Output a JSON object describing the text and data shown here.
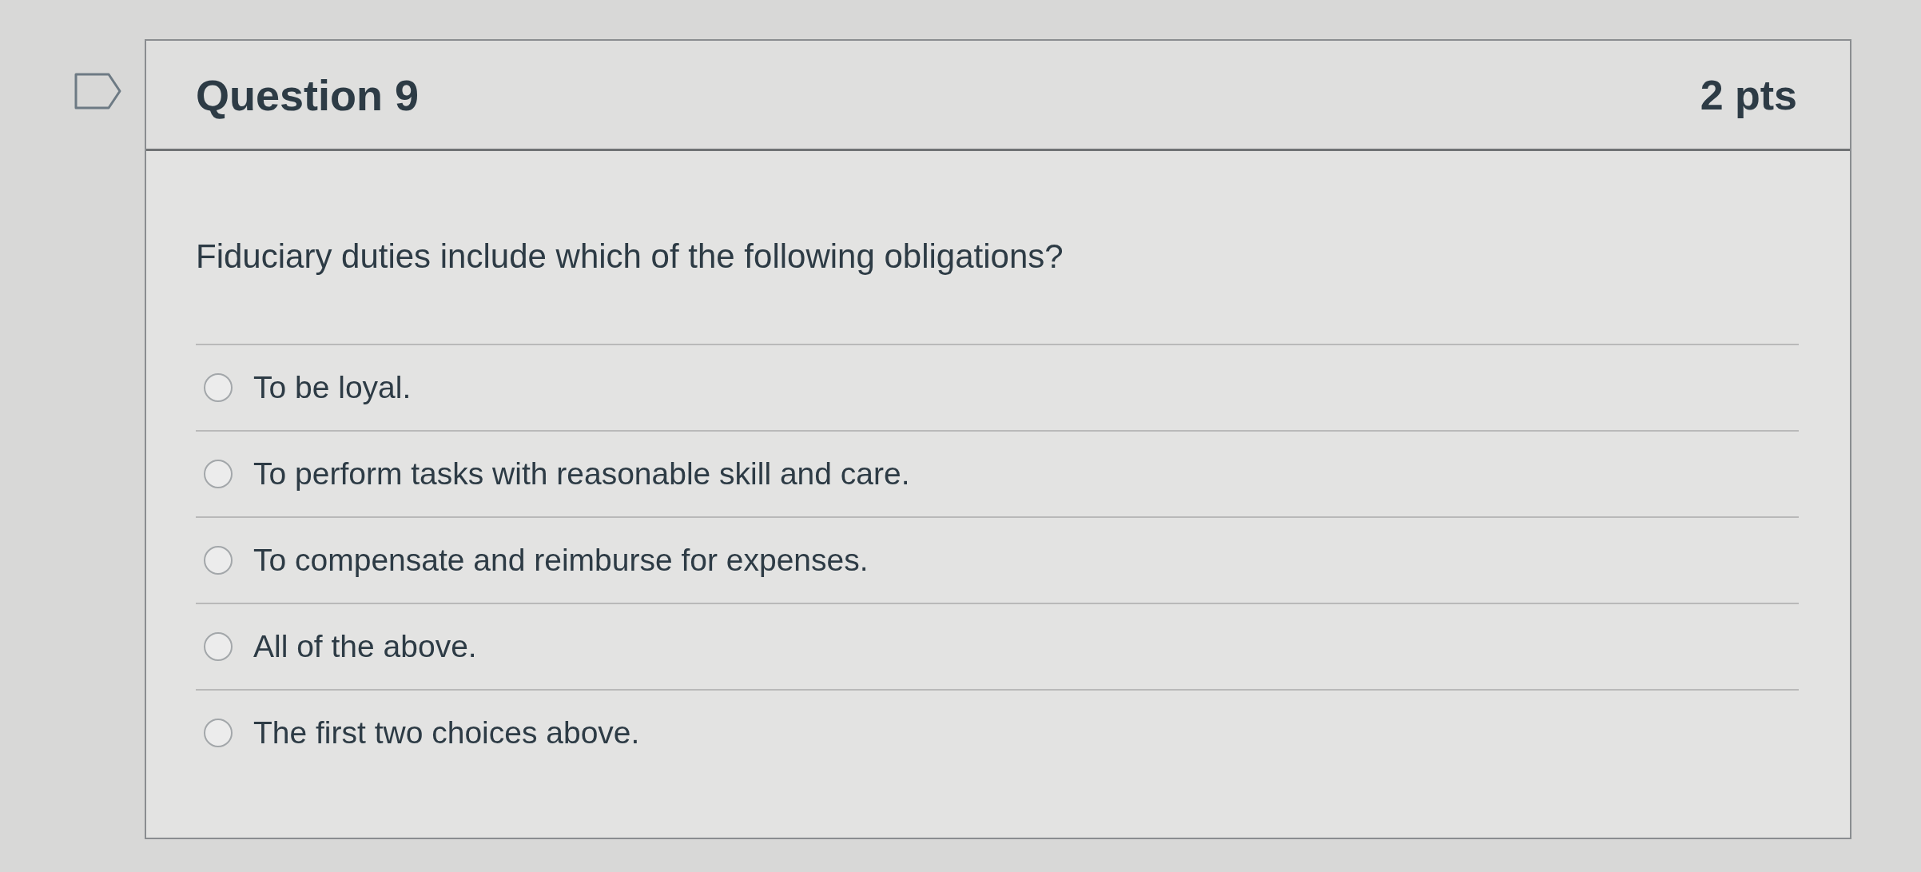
{
  "question": {
    "flagged": false,
    "title": "Question 9",
    "points": "2 pts",
    "prompt": "Fiduciary duties include which of the following obligations?",
    "answers": [
      {
        "label": "To be loyal.",
        "selected": false
      },
      {
        "label": "To perform tasks with reasonable skill and care.",
        "selected": false
      },
      {
        "label": "To compensate and reimburse for expenses.",
        "selected": false
      },
      {
        "label": "All of the above.",
        "selected": false
      },
      {
        "label": "The first two choices above.",
        "selected": false
      }
    ]
  }
}
